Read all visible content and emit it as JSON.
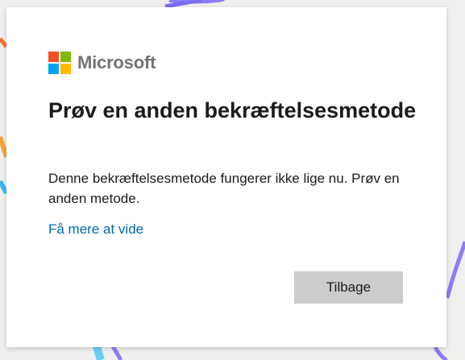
{
  "brand": {
    "name": "Microsoft",
    "logo_colors": [
      "#f25022",
      "#7fba00",
      "#00a4ef",
      "#ffb900"
    ]
  },
  "dialog": {
    "title": "Prøv en anden bekræftelsesmetode",
    "description": "Denne bekræftelsesmetode fungerer ikke lige nu. Prøv en anden metode.",
    "link_label": "Få mere at vide",
    "back_button_label": "Tilbage"
  },
  "colors": {
    "link": "#0067b8",
    "button_bg": "#cccccc",
    "page_bg": "#f0efee"
  }
}
